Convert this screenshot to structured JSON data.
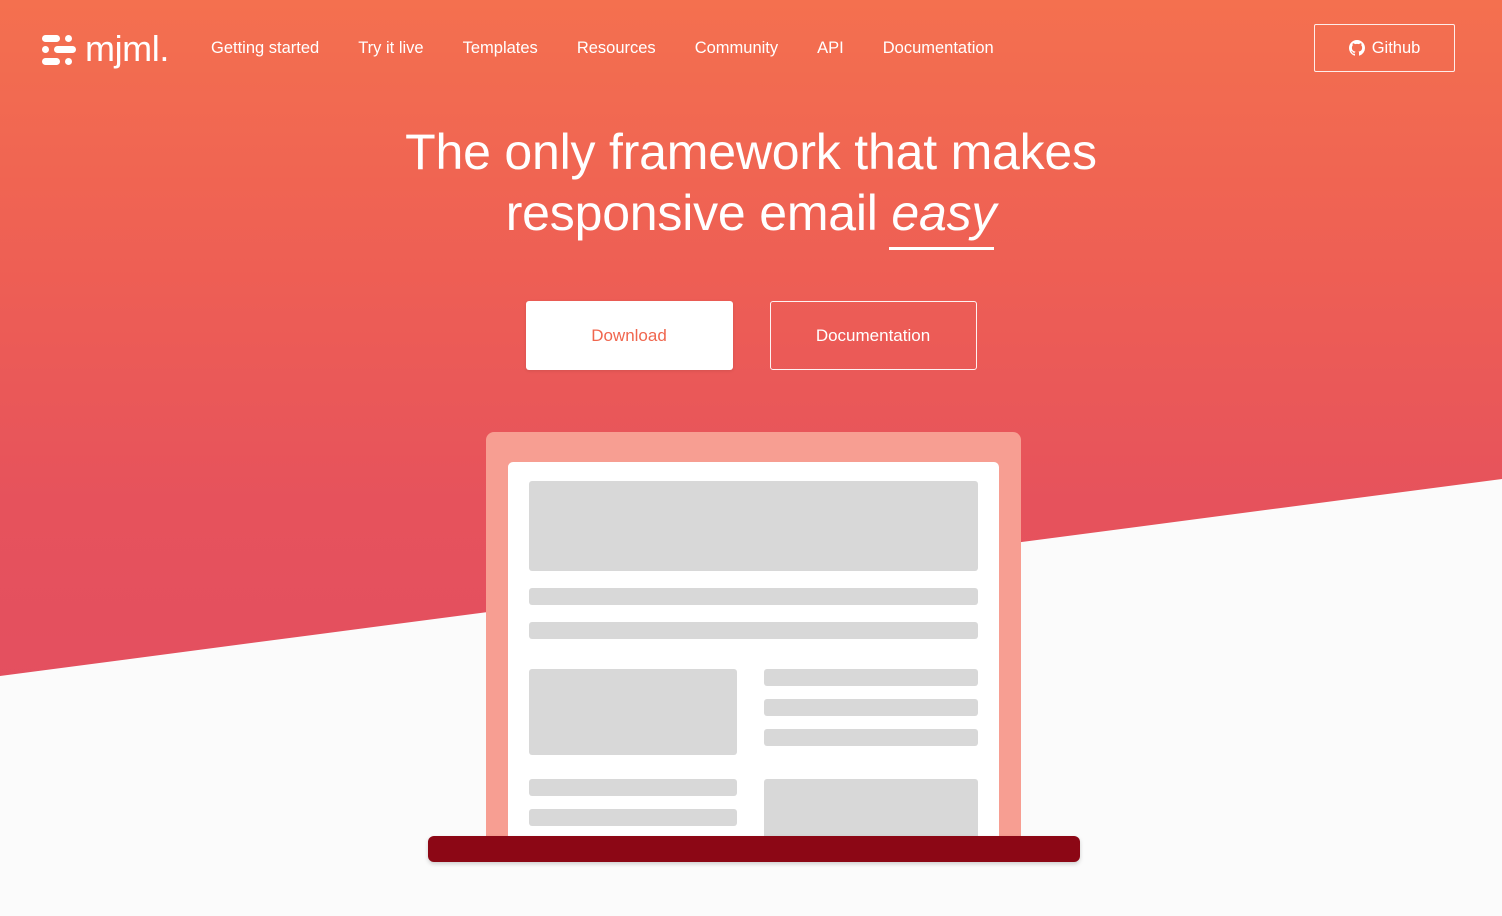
{
  "brand": {
    "name": "mjml.",
    "logo_icon": "mjml-mark-icon"
  },
  "nav": {
    "links": [
      {
        "label": "Getting started"
      },
      {
        "label": "Try it live"
      },
      {
        "label": "Templates"
      },
      {
        "label": "Resources"
      },
      {
        "label": "Community"
      },
      {
        "label": "API"
      },
      {
        "label": "Documentation"
      }
    ],
    "github": {
      "label": "Github",
      "icon": "github-icon"
    }
  },
  "hero": {
    "headline_part1": "The only framework that makes",
    "headline_part2": "responsive email",
    "headline_emphasis": "easy",
    "buttons": {
      "primary": "Download",
      "secondary": "Documentation"
    }
  },
  "illustration": {
    "name": "laptop-email-wireframe"
  },
  "colors": {
    "gradient_top": "#F4704F",
    "gradient_bottom": "#E34F60",
    "page_background": "#FBFBFB",
    "laptop_bezel": "#F79E92",
    "laptop_base": "#8C0715",
    "wireframe_block": "#D8D8D8",
    "primary_button_text": "#F0664E",
    "text_on_hero": "#FFFFFF"
  }
}
